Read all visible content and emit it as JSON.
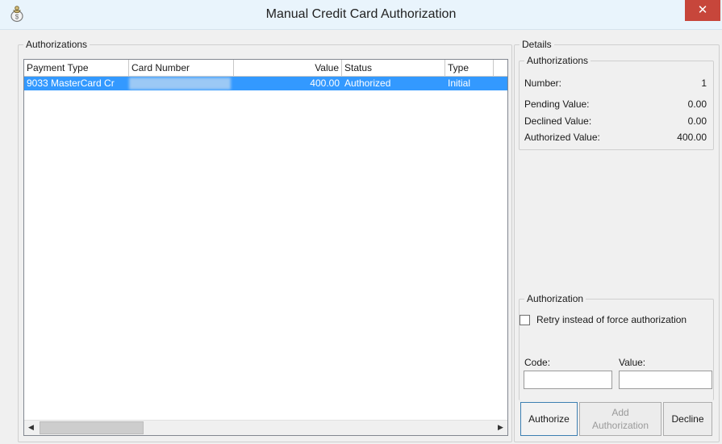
{
  "window": {
    "title": "Manual Credit Card Authorization",
    "close_glyph": "✕",
    "app_icon": "money-bag-icon"
  },
  "authorizations": {
    "group_label": "Authorizations",
    "columns": [
      "Payment Type",
      "Card Number",
      "Value",
      "Status",
      "Type"
    ],
    "rows": [
      {
        "payment_type": "9033 MasterCard Cr",
        "card_number": "",
        "value": "400.00",
        "status": "Authorized",
        "type": "Initial",
        "selected": true
      }
    ],
    "scroll_left_glyph": "◀",
    "scroll_right_glyph": "▶"
  },
  "details": {
    "group_label": "Details",
    "authorizations_label": "Authorizations",
    "number_label": "Number:",
    "number_value": "1",
    "pending_label": "Pending Value:",
    "pending_value": "0.00",
    "declined_label": "Declined Value:",
    "declined_value": "0.00",
    "authorized_label": "Authorized Value:",
    "authorized_value": "400.00"
  },
  "authorization": {
    "group_label": "Authorization",
    "retry_label": "Retry instead of force authorization",
    "retry_checked": false,
    "code_label": "Code:",
    "code_value": "",
    "value_label": "Value:",
    "value_value": "",
    "authorize_btn": "Authorize",
    "add_btn_line1": "Add",
    "add_btn_line2": "Authorization",
    "decline_btn": "Decline"
  },
  "colors": {
    "selection": "#3399ff",
    "close": "#c7463b",
    "titlebar": "#e9f4fc"
  }
}
